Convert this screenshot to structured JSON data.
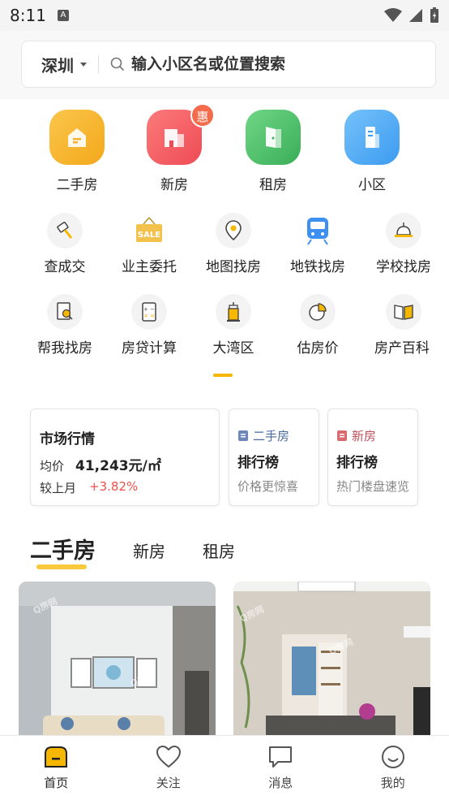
{
  "status_bar": {
    "time": "8:11",
    "notification_icon": "A"
  },
  "search": {
    "city": "深圳",
    "placeholder": "输入小区名或位置搜索"
  },
  "main_categories": [
    {
      "label": "二手房",
      "icon": "house-icon",
      "color": "#f7b731"
    },
    {
      "label": "新房",
      "icon": "building-icon",
      "color": "#f25c5c",
      "badge": "惠"
    },
    {
      "label": "租房",
      "icon": "door-icon",
      "color": "#4cc06a"
    },
    {
      "label": "小区",
      "icon": "apartment-icon",
      "color": "#4aa8f2"
    }
  ],
  "tools_row1": [
    {
      "label": "查成交",
      "icon": "hammer-icon"
    },
    {
      "label": "业主委托",
      "icon": "sale-tag-icon",
      "tag": "SALE"
    },
    {
      "label": "地图找房",
      "icon": "map-pin-icon"
    },
    {
      "label": "地铁找房",
      "icon": "subway-icon"
    },
    {
      "label": "学校找房",
      "icon": "school-bell-icon"
    }
  ],
  "tools_row2": [
    {
      "label": "帮我找房",
      "icon": "search-doc-icon"
    },
    {
      "label": "房贷计算",
      "icon": "calculator-icon"
    },
    {
      "label": "大湾区",
      "icon": "tower-icon"
    },
    {
      "label": "估房价",
      "icon": "pie-chart-icon"
    },
    {
      "label": "房产百科",
      "icon": "book-icon"
    }
  ],
  "market": {
    "title": "市场行情",
    "avg_label": "均价",
    "avg_value": "41,243元/㎡",
    "mom_label": "较上月",
    "mom_value": "+3.82%"
  },
  "rank_secondhand": {
    "tag": "二手房",
    "title": "排行榜",
    "subtitle": "价格更惊喜"
  },
  "rank_new": {
    "tag": "新房",
    "title": "排行榜",
    "subtitle": "热门楼盘速览"
  },
  "listing_tabs": [
    "二手房",
    "新房",
    "租房"
  ],
  "watermark": "Q房网",
  "bottom_nav": [
    {
      "label": "首页",
      "icon": "home-icon"
    },
    {
      "label": "关注",
      "icon": "heart-icon"
    },
    {
      "label": "消息",
      "icon": "message-icon"
    },
    {
      "label": "我的",
      "icon": "smile-icon"
    }
  ],
  "colors": {
    "accent": "#f5b700",
    "up_red": "#f0504a"
  }
}
